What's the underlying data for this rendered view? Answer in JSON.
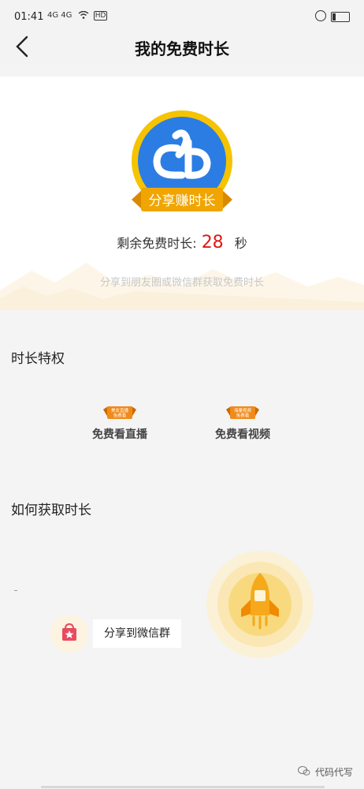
{
  "status_bar": {
    "time": "01:41",
    "signal_text": "4G 4G",
    "hd_text": "HD"
  },
  "header": {
    "title": "我的免费时长"
  },
  "badge": {
    "label": "分享赚时长",
    "brand_color": "#2b7de4",
    "ring_color": "#f5c300",
    "ribbon_color": "#f0a500"
  },
  "remaining": {
    "label": "剩余免费时长:",
    "value": "28",
    "unit": "秒",
    "value_color": "#e01616"
  },
  "share_hint": "分享到朋友圈或微信群获取免费时长",
  "privileges": {
    "title": "时长特权",
    "items": [
      {
        "tag": "美女直播 免费看",
        "label": "免费看直播",
        "icon": "live-tag-icon"
      },
      {
        "tag": "海量视频 免费看",
        "label": "免费看视频",
        "icon": "video-tag-icon"
      }
    ]
  },
  "how_to": {
    "title": "如何获取时长",
    "share_button": "分享到微信群",
    "share_icon": "shopping-bag-star-icon",
    "rocket_icon": "rocket-icon"
  },
  "watermark": "代码代写"
}
